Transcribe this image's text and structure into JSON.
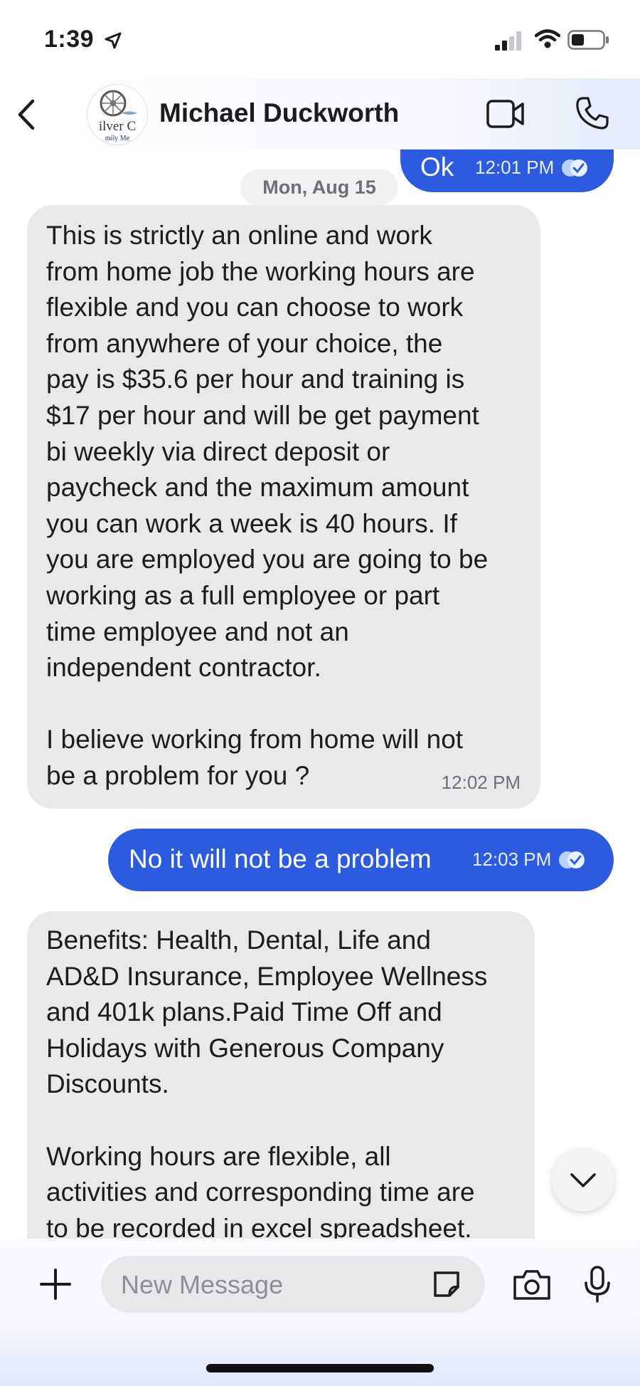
{
  "status_bar": {
    "time": "1:39",
    "location_icon": "location-arrow-icon",
    "signal_icon": "cellular-signal-icon",
    "wifi_icon": "wifi-icon",
    "battery_icon": "battery-icon"
  },
  "header": {
    "back_icon": "chevron-left-icon",
    "contact_name": "Michael Duckworth",
    "avatar_text": "ilver C",
    "avatar_subtext": "mily Me",
    "video_icon": "video-camera-icon",
    "phone_icon": "phone-icon"
  },
  "thread": {
    "date_separator": "Mon, Aug 15",
    "messages": [
      {
        "direction": "outgoing",
        "text": "Ok",
        "time": "12:01 PM",
        "status": "read"
      },
      {
        "direction": "incoming",
        "text": "This is strictly an online and work\nfrom home job the working hours are\nflexible and you can choose to work\nfrom anywhere of your choice, the\npay is $35.6 per hour and training is\n$17 per hour and will be get payment\nbi weekly via direct deposit or\npaycheck and the maximum amount\nyou can work a week is 40 hours. If\nyou are employed you are going to be\nworking as a full employee or part\ntime employee and not an\nindependent contractor.\n\nI believe working from home will not\nbe a problem for you ?",
        "time": "12:02 PM"
      },
      {
        "direction": "outgoing",
        "text": "No it will not be a problem",
        "time": "12:03 PM",
        "status": "read"
      },
      {
        "direction": "incoming",
        "text": "Benefits: Health, Dental, Life and\nAD&D Insurance, Employee Wellness\nand 401k plans.Paid Time Off and\nHolidays with Generous Company\nDiscounts.\n\nWorking hours are flexible, all\nactivities and corresponding time are\nto be recorded in excel spreadsheet."
      }
    ]
  },
  "scroll_down_icon": "chevron-down-icon",
  "composer": {
    "add_icon": "plus-icon",
    "placeholder": "New Message",
    "sticker_icon": "sticker-icon",
    "camera_icon": "camera-icon",
    "mic_icon": "microphone-icon"
  },
  "colors": {
    "outgoing_bubble": "#2c5be0",
    "incoming_bubble": "#e9e9eb",
    "background": "#ffffff"
  }
}
